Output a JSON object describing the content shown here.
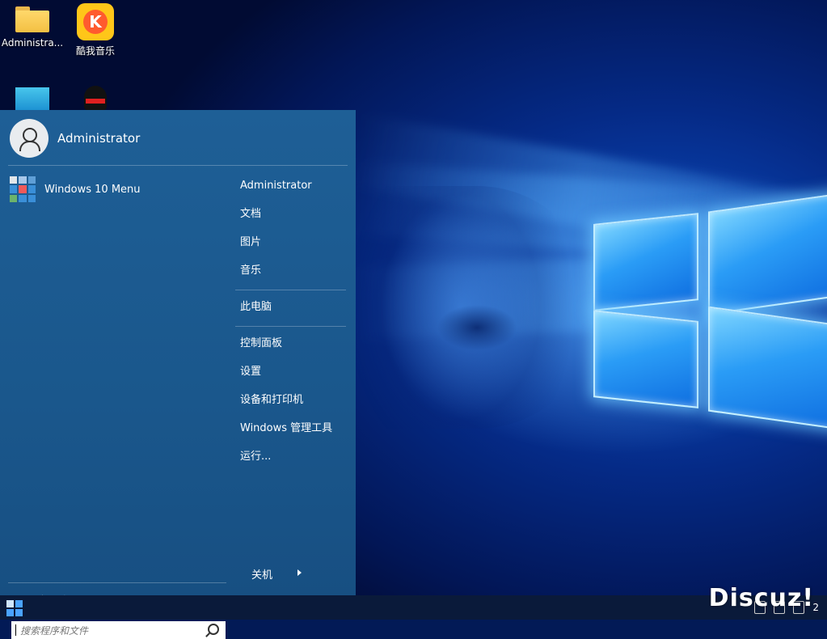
{
  "desktop": {
    "icons": [
      {
        "label": "Administra...",
        "icon": "folder-icon"
      },
      {
        "label": "酷我音乐",
        "icon": "kuwo-music-icon"
      },
      {
        "label": "",
        "icon": "computer-icon"
      },
      {
        "label": "",
        "icon": "qq-penguin-icon"
      }
    ]
  },
  "start_menu": {
    "user": {
      "name": "Administrator"
    },
    "apps": [
      {
        "label": "Windows 10 Menu",
        "icon": "windows-10-menu-icon"
      }
    ],
    "all_programs": "所有程序",
    "search": {
      "placeholder": "搜索程序和文件"
    },
    "right_items": {
      "group1": [
        "Administrator",
        "文档",
        "图片",
        "音乐"
      ],
      "group2": [
        "此电脑"
      ],
      "group3": [
        "控制面板",
        "设置",
        "设备和打印机",
        "Windows 管理工具",
        "运行..."
      ]
    },
    "shutdown": "关机"
  },
  "taskbar": {
    "clock": "2"
  },
  "watermark": "Discuz!",
  "colors": {
    "start_menu_bg": "#1e5f96",
    "taskbar_bg": "#0a1a3a",
    "desktop_accent": "#0b4fc6"
  }
}
